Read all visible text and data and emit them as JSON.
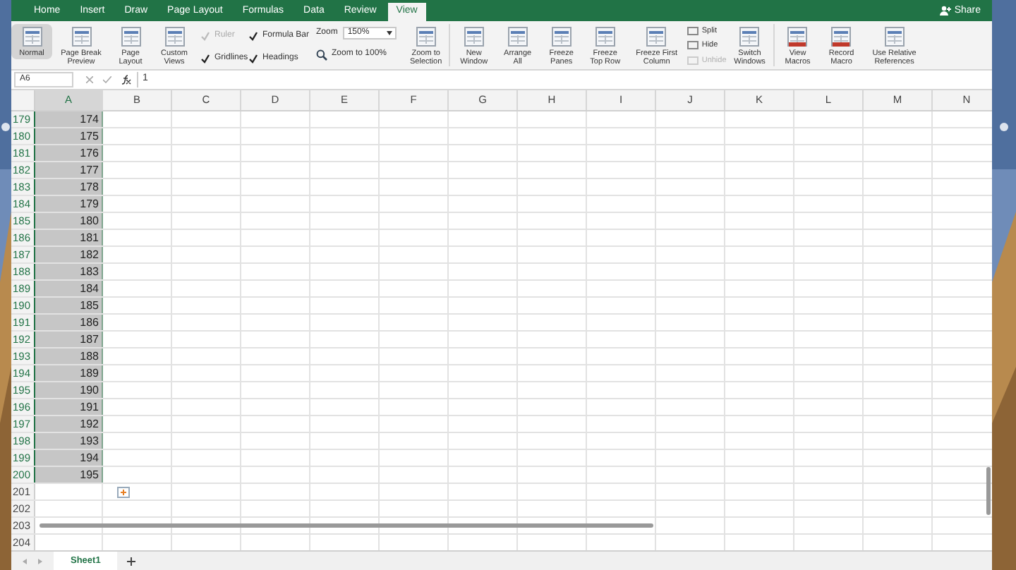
{
  "tabs": [
    {
      "label": "Home",
      "selected": false
    },
    {
      "label": "Insert",
      "selected": false
    },
    {
      "label": "Draw",
      "selected": false
    },
    {
      "label": "Page Layout",
      "selected": false
    },
    {
      "label": "Formulas",
      "selected": false
    },
    {
      "label": "Data",
      "selected": false
    },
    {
      "label": "Review",
      "selected": false
    },
    {
      "label": "View",
      "selected": true
    }
  ],
  "share": "Share",
  "views": [
    {
      "label": "Normal",
      "selected": true
    },
    {
      "label": "Page Break Preview",
      "selected": false
    },
    {
      "label": "Page Layout",
      "selected": false
    },
    {
      "label": "Custom Views",
      "selected": false
    }
  ],
  "show": [
    {
      "label": "Ruler",
      "checked": true,
      "disabled": true
    },
    {
      "label": "Formula Bar",
      "checked": true,
      "disabled": false
    },
    {
      "label": "Gridlines",
      "checked": true,
      "disabled": false
    },
    {
      "label": "Headings",
      "checked": true,
      "disabled": false
    }
  ],
  "zoom": {
    "label": "Zoom",
    "value": "150%",
    "to100": "Zoom to 100%",
    "selection": "Zoom to Selection"
  },
  "window_buttons": [
    {
      "label": "New Window"
    },
    {
      "label": "Arrange All"
    },
    {
      "label": "Freeze Panes"
    },
    {
      "label": "Freeze Top Row"
    },
    {
      "label": "Freeze First Column"
    }
  ],
  "split": [
    {
      "label": "Split",
      "disabled": false
    },
    {
      "label": "Hide",
      "disabled": false
    },
    {
      "label": "Unhide",
      "disabled": true
    }
  ],
  "switch": "Switch Windows",
  "macros": [
    {
      "label": "View Macros"
    },
    {
      "label": "Record Macro"
    },
    {
      "label": "Use Relative References"
    }
  ],
  "formula_bar": {
    "name_box": "A6",
    "value": "1"
  },
  "columns": [
    "A",
    "B",
    "C",
    "D",
    "E",
    "F",
    "G",
    "H",
    "I",
    "J",
    "K",
    "L",
    "M",
    "N"
  ],
  "rows": [
    {
      "header": "179",
      "value": "174",
      "selected": true
    },
    {
      "header": "180",
      "value": "175",
      "selected": true
    },
    {
      "header": "181",
      "value": "176",
      "selected": true
    },
    {
      "header": "182",
      "value": "177",
      "selected": true
    },
    {
      "header": "183",
      "value": "178",
      "selected": true
    },
    {
      "header": "184",
      "value": "179",
      "selected": true
    },
    {
      "header": "185",
      "value": "180",
      "selected": true
    },
    {
      "header": "186",
      "value": "181",
      "selected": true
    },
    {
      "header": "187",
      "value": "182",
      "selected": true
    },
    {
      "header": "188",
      "value": "183",
      "selected": true
    },
    {
      "header": "189",
      "value": "184",
      "selected": true
    },
    {
      "header": "190",
      "value": "185",
      "selected": true
    },
    {
      "header": "191",
      "value": "186",
      "selected": true
    },
    {
      "header": "192",
      "value": "187",
      "selected": true
    },
    {
      "header": "193",
      "value": "188",
      "selected": true
    },
    {
      "header": "194",
      "value": "189",
      "selected": true
    },
    {
      "header": "195",
      "value": "190",
      "selected": true
    },
    {
      "header": "196",
      "value": "191",
      "selected": true
    },
    {
      "header": "197",
      "value": "192",
      "selected": true
    },
    {
      "header": "198",
      "value": "193",
      "selected": true
    },
    {
      "header": "199",
      "value": "194",
      "selected": true
    },
    {
      "header": "200",
      "value": "195",
      "selected": true
    },
    {
      "header": "201",
      "value": null,
      "selected": false
    },
    {
      "header": "202",
      "value": null,
      "selected": false
    },
    {
      "header": "203",
      "value": null,
      "selected": false
    },
    {
      "header": "204",
      "value": null,
      "selected": false
    }
  ],
  "sheets": [
    {
      "label": "Sheet1",
      "selected": true
    }
  ]
}
